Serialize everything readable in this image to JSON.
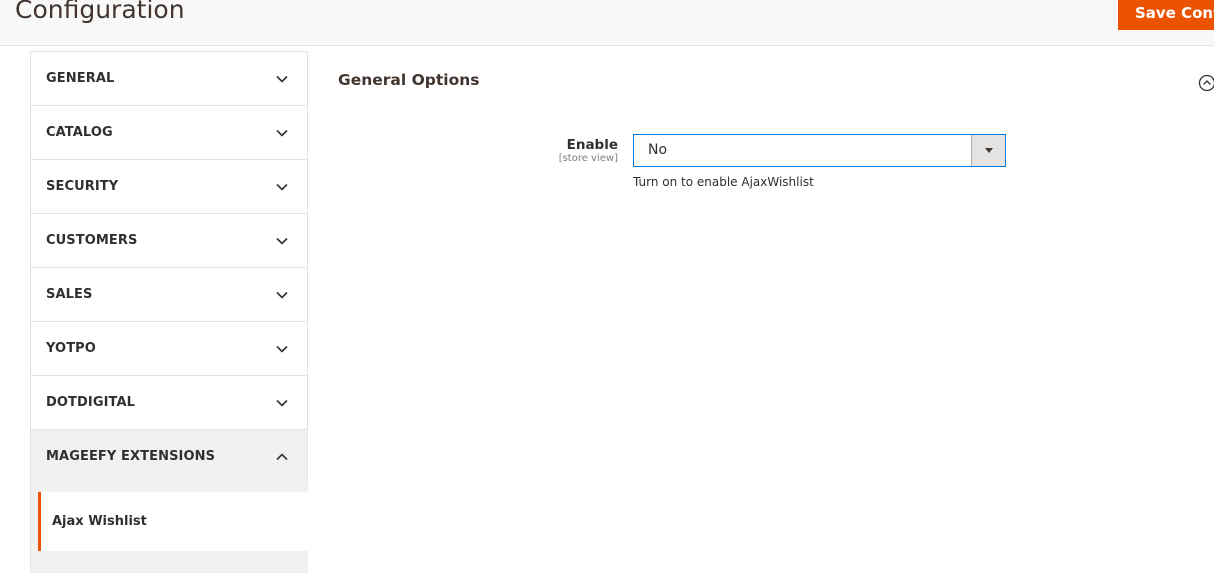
{
  "header": {
    "title": "Configuration",
    "save_label": "Save Config",
    "accent_color": "#eb5202"
  },
  "sidebar": {
    "items": [
      {
        "label": "GENERAL",
        "state": "collapsed",
        "icon": "chevron-down-icon"
      },
      {
        "label": "CATALOG",
        "state": "collapsed",
        "icon": "chevron-down-icon"
      },
      {
        "label": "SECURITY",
        "state": "collapsed",
        "icon": "chevron-down-icon"
      },
      {
        "label": "CUSTOMERS",
        "state": "collapsed",
        "icon": "chevron-down-icon"
      },
      {
        "label": "SALES",
        "state": "collapsed",
        "icon": "chevron-down-icon"
      },
      {
        "label": "YOTPO",
        "state": "collapsed",
        "icon": "chevron-down-icon"
      },
      {
        "label": "DOTDIGITAL",
        "state": "collapsed",
        "icon": "chevron-down-icon"
      },
      {
        "label": "MAGEEFY EXTENSIONS",
        "state": "expanded",
        "icon": "chevron-up-icon"
      }
    ],
    "sub_items": [
      {
        "label": "Ajax Wishlist",
        "active": true
      }
    ]
  },
  "section": {
    "title": "General Options",
    "collapse_icon": "collapse-circle-icon"
  },
  "field": {
    "label": "Enable",
    "scope": "[store view]",
    "value": "No",
    "note": "Turn on to enable AjaxWishlist"
  }
}
